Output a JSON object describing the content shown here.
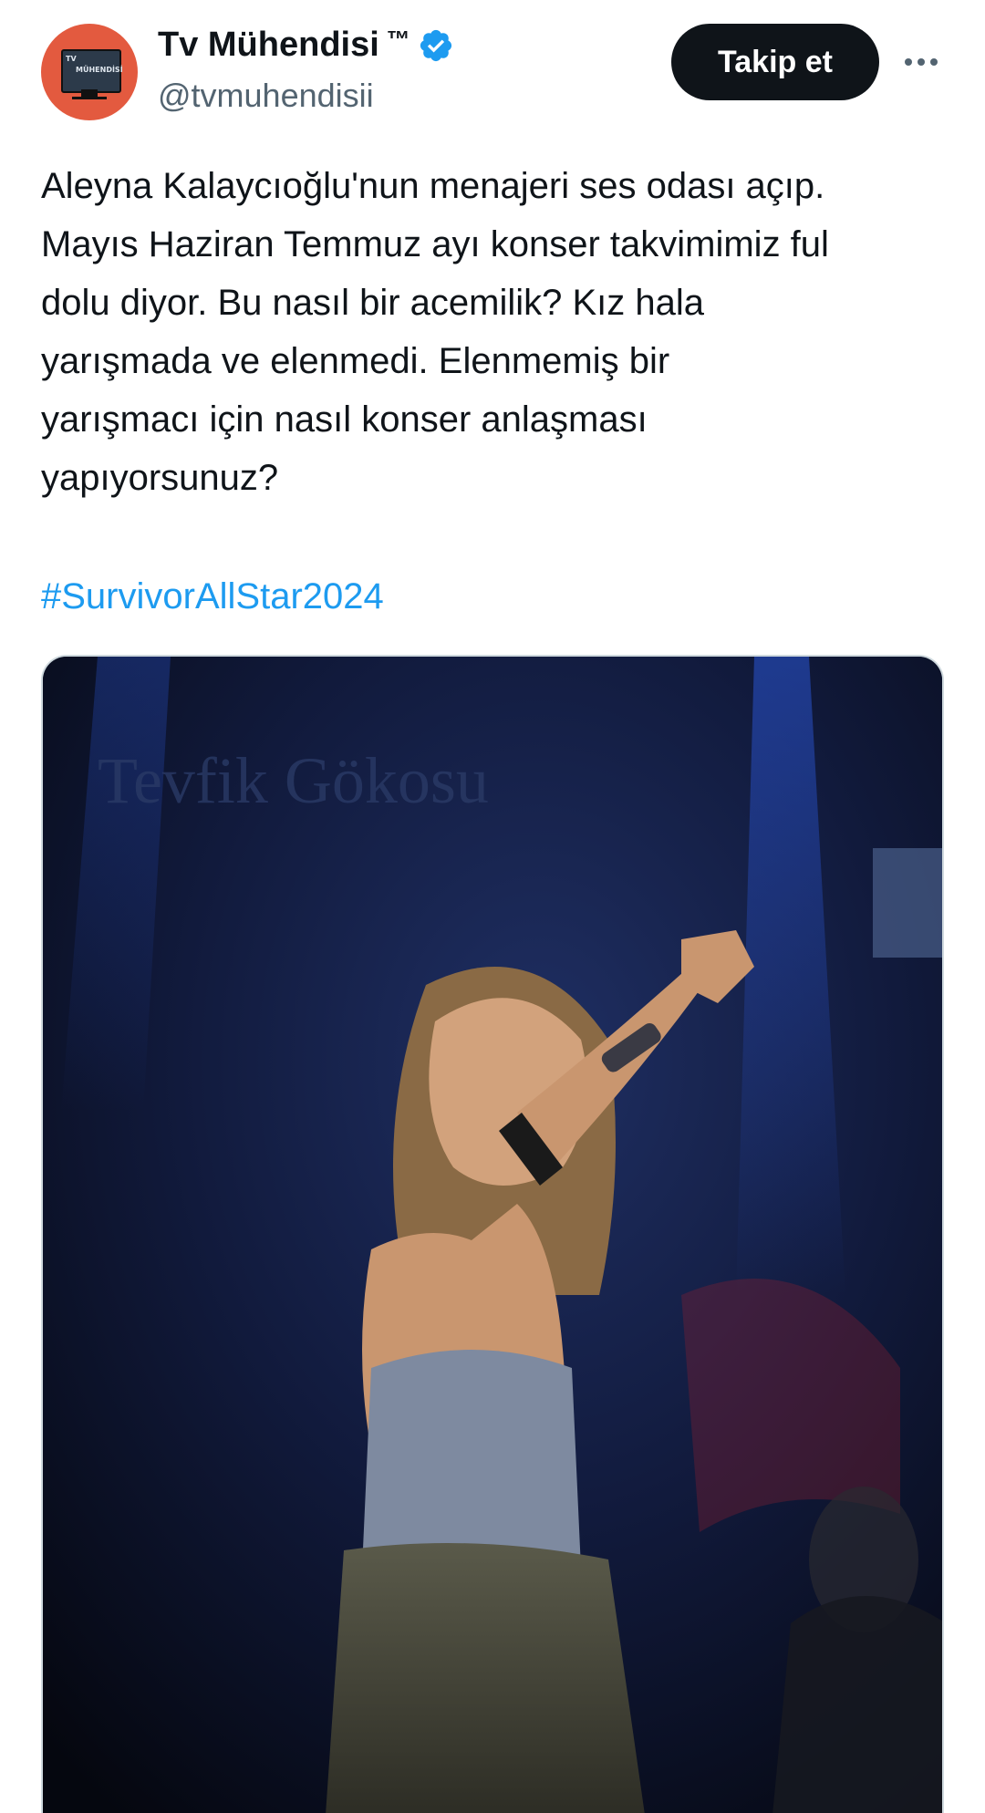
{
  "author": {
    "display_name": "Tv Mühendisi",
    "trademark": "™",
    "handle": "@tvmuhendisii",
    "verified": true,
    "avatar_text": [
      "TV",
      "MÜHENDİSİ"
    ]
  },
  "actions": {
    "follow_label": "Takip et",
    "more_icon": "more-horizontal-icon"
  },
  "tweet": {
    "lines": [
      "Aleyna Kalaycıoğlu'nun menajeri ses odası açıp.",
      "Mayıs Haziran Temmuz ayı konser takvimimiz ful",
      "dolu diyor. Bu nasıl bir acemilik? Kız hala",
      "yarışmada ve elenmedi. Elenmemiş bir",
      "yarışmacı için nasıl konser anlaşması",
      "yapıyorsunuz?"
    ],
    "hashtag": "#SurvivorAllStar2024"
  },
  "media": {
    "backdrop_text": "Tevfik Gökosu"
  },
  "colors": {
    "accent": "#1d9bf0",
    "text": "#0f1419",
    "secondary": "#536471",
    "button": "#0f1419",
    "avatar": "#e35a3f"
  }
}
